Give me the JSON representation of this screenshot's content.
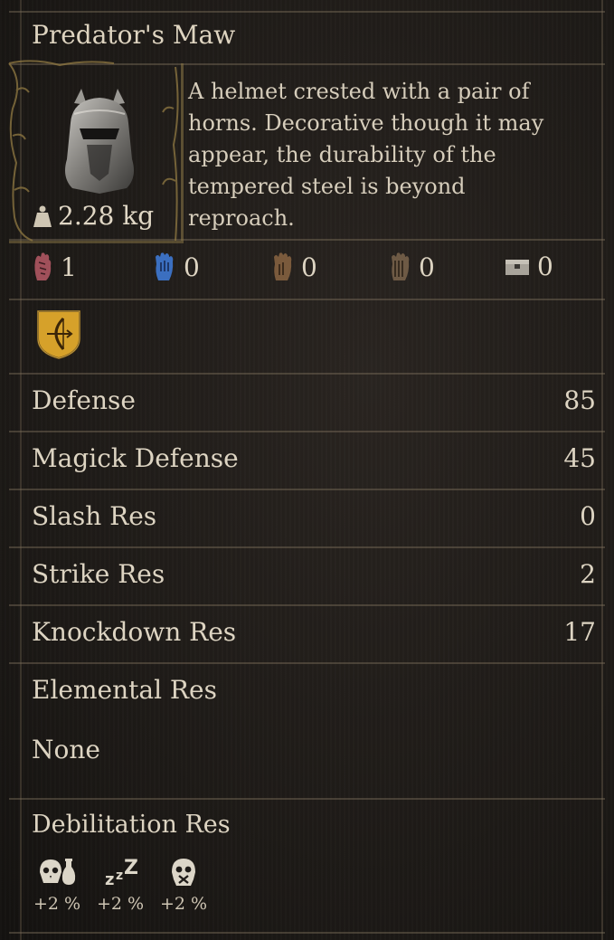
{
  "item": {
    "name": "Predator's Maw",
    "weight": "2.28 kg",
    "description": "A helmet crested with a pair of horns. Decorative though it may appear, the durability of the tempered steel is beyond reproach."
  },
  "vocations": [
    {
      "icon": "fighter-hand-icon",
      "value": "1",
      "color": "#a0505a"
    },
    {
      "icon": "mage-hand-icon",
      "value": "0",
      "color": "#3b6fc0"
    },
    {
      "icon": "thief-hand-icon",
      "value": "0",
      "color": "#7a5a3c"
    },
    {
      "icon": "warrior-hand-icon",
      "value": "0",
      "color": "#6e5a45"
    },
    {
      "icon": "storage-chest-icon",
      "value": "0",
      "color": "#a8a39a"
    }
  ],
  "vocation_badge": {
    "icon": "archer-bow-shield-icon",
    "color": "#d6a12a"
  },
  "stats": [
    {
      "label": "Defense",
      "value": "85"
    },
    {
      "label": "Magick Defense",
      "value": "45"
    },
    {
      "label": "Slash Res",
      "value": "0"
    },
    {
      "label": "Strike Res",
      "value": "2"
    },
    {
      "label": "Knockdown Res",
      "value": "17"
    }
  ],
  "elemental": {
    "heading": "Elemental Res",
    "value": "None"
  },
  "debilitation": {
    "heading": "Debilitation Res",
    "items": [
      {
        "icon": "poison-skull-icon",
        "value": "+2 %"
      },
      {
        "icon": "sleep-zz-icon",
        "value": "+2 %"
      },
      {
        "icon": "silence-skull-icon",
        "value": "+2 %"
      }
    ]
  }
}
